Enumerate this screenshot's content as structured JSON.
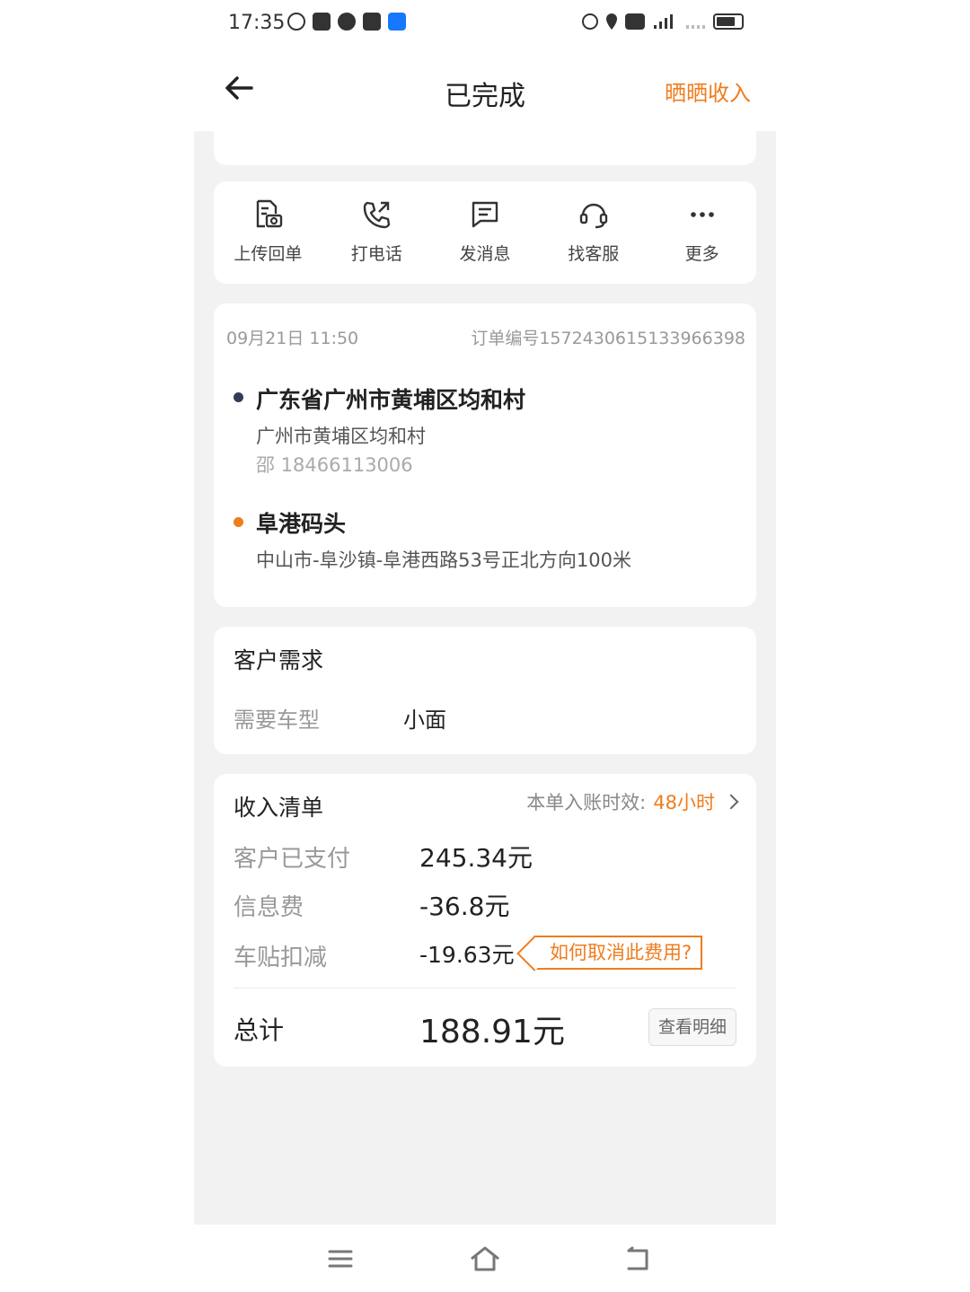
{
  "status_bar": {
    "time": "17:35",
    "left_icons": [
      "k-icon",
      "app-icon",
      "chat-icon",
      "message-icon",
      "alipay-icon"
    ],
    "right_icons": [
      "alarm-icon",
      "location-icon",
      "hd-icon",
      "5g-signal-icon",
      "signal-icon",
      "battery-icon"
    ]
  },
  "nav": {
    "title": "已完成",
    "action": "晒晒收入"
  },
  "actions": [
    {
      "label": "上传回单",
      "icon": "receipt-upload-icon"
    },
    {
      "label": "打电话",
      "icon": "phone-icon"
    },
    {
      "label": "发消息",
      "icon": "message-icon"
    },
    {
      "label": "找客服",
      "icon": "headset-icon"
    },
    {
      "label": "更多",
      "icon": "more-icon"
    }
  ],
  "order": {
    "datetime": "09月21日  11:50",
    "order_no": "订单编号1572430615133966398",
    "origin": {
      "title": "广东省广州市黄埔区均和村",
      "detail": "广州市黄埔区均和村",
      "contact": "邵  18466113006"
    },
    "destination": {
      "title": "阜港码头",
      "detail": "中山市-阜沙镇-阜港西路53号正北方向100米"
    }
  },
  "demand": {
    "title": "客户需求",
    "key": "需要车型",
    "value": "小面"
  },
  "income": {
    "title": "收入清单",
    "timing_label": "本单入账时效:",
    "timing_value": "48小时",
    "rows": [
      {
        "key": "客户已支付",
        "value": "245.34元"
      },
      {
        "key": "信息费",
        "value": "-36.8元"
      },
      {
        "key": "车贴扣减",
        "value": "-19.63元"
      }
    ],
    "tip": "如何取消此费用?",
    "total_label": "总计",
    "total_value": "188.91元",
    "detail_button": "查看明细"
  },
  "colors": {
    "accent": "#f07c1e",
    "background": "#f2f2f2"
  }
}
